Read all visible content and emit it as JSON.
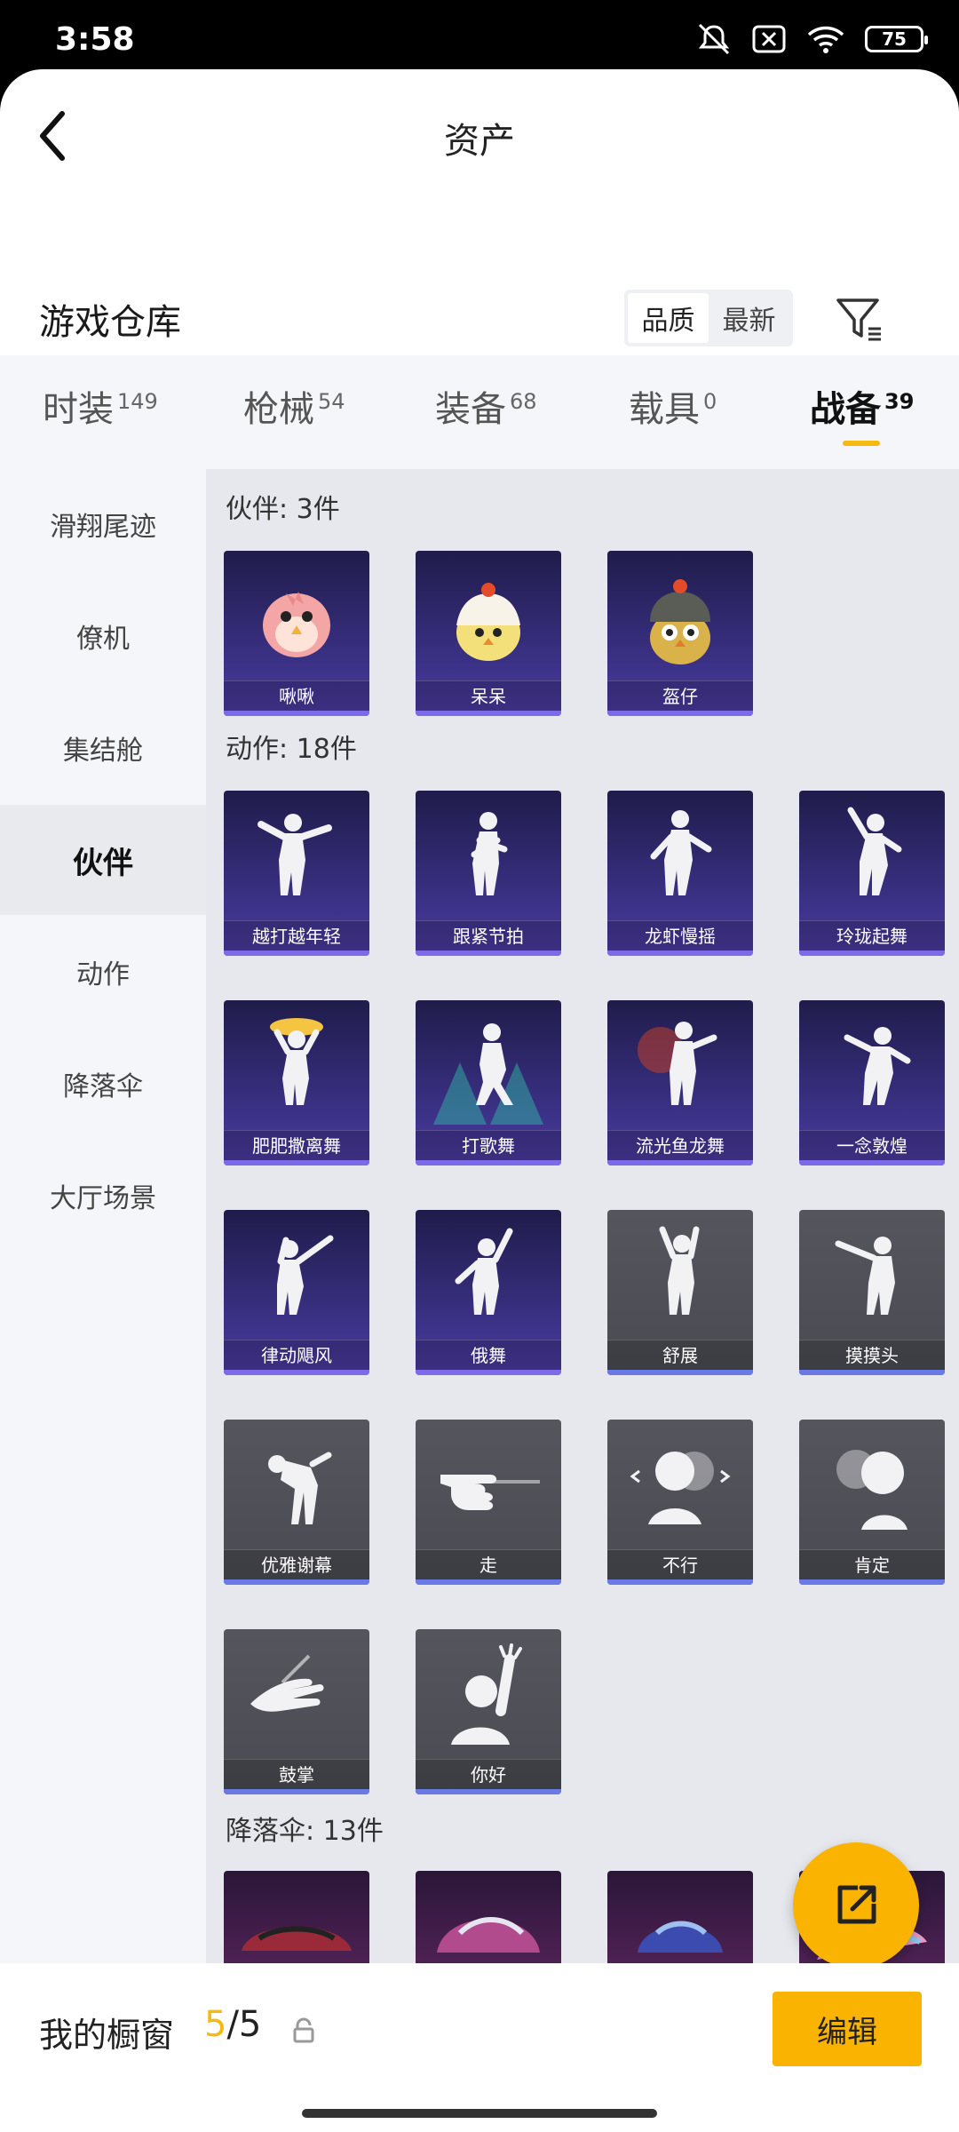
{
  "status_bar": {
    "time": "3:58",
    "battery": "75"
  },
  "header": {
    "title": "资产"
  },
  "section": {
    "title": "游戏仓库",
    "sort_options": [
      "品质",
      "最新"
    ],
    "sort_selected": "品质"
  },
  "tabs": [
    {
      "label": "时装",
      "count": "149"
    },
    {
      "label": "枪械",
      "count": "54"
    },
    {
      "label": "装备",
      "count": "68"
    },
    {
      "label": "载具",
      "count": "0"
    },
    {
      "label": "战备",
      "count": "39",
      "active": true
    }
  ],
  "sidebar": {
    "items": [
      "滑翔尾迹",
      "僚机",
      "集结舱",
      "伙伴",
      "动作",
      "降落伞",
      "大厅场景"
    ],
    "active": "伙伴"
  },
  "groups": {
    "partners": {
      "title": "伙伴: 3件",
      "items": [
        "啾啾",
        "呆呆",
        "盔仔"
      ]
    },
    "emotes": {
      "title": "动作: 18件",
      "items": [
        "越打越年轻",
        "跟紧节拍",
        "龙虾慢摇",
        "玲珑起舞",
        "肥肥撒离舞",
        "打歌舞",
        "流光鱼龙舞",
        "一念敦煌",
        "律动飓风",
        "俄舞",
        "舒展",
        "摸摸头",
        "优雅谢幕",
        "走",
        "不行",
        "肯定",
        "鼓掌",
        "你好"
      ]
    },
    "parachutes": {
      "title": "降落伞: 13件"
    }
  },
  "showcase": {
    "label": "我的橱窗",
    "current": "5",
    "total": "/5",
    "edit_label": "编辑"
  },
  "colors": {
    "accent": "#f9b300",
    "card_purple": "#3c3288",
    "card_gray": "#4a4b52"
  }
}
